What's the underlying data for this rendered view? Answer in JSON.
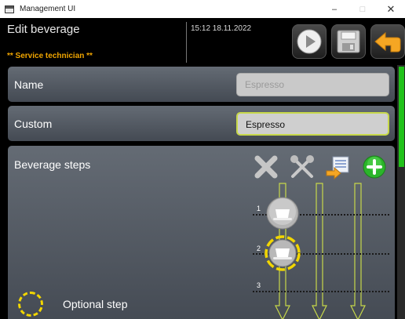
{
  "window": {
    "title": "Management UI",
    "minimize": "–",
    "maximize": "□",
    "close": "✕"
  },
  "header": {
    "title": "Edit beverage",
    "role": "** Service technician **",
    "datetime": "15:12 18.11.2022"
  },
  "toolbar": {
    "play_icon": "play-icon",
    "save_icon": "floppy-disk-icon",
    "back_icon": "back-arrow-icon"
  },
  "form": {
    "name_label": "Name",
    "name_value": "Espresso",
    "custom_label": "Custom",
    "custom_value": "Espresso"
  },
  "steps": {
    "label": "Beverage steps",
    "actions": [
      "delete-icon",
      "tools-icon",
      "import-icon",
      "add-icon"
    ],
    "step_numbers": [
      "1",
      "2",
      "3"
    ],
    "legend_text": "Optional step"
  },
  "colors": {
    "accent_green": "#21c21a",
    "role_orange": "#f0a500",
    "optional_yellow": "#f2d600",
    "lane_green": "#c7d84a"
  }
}
